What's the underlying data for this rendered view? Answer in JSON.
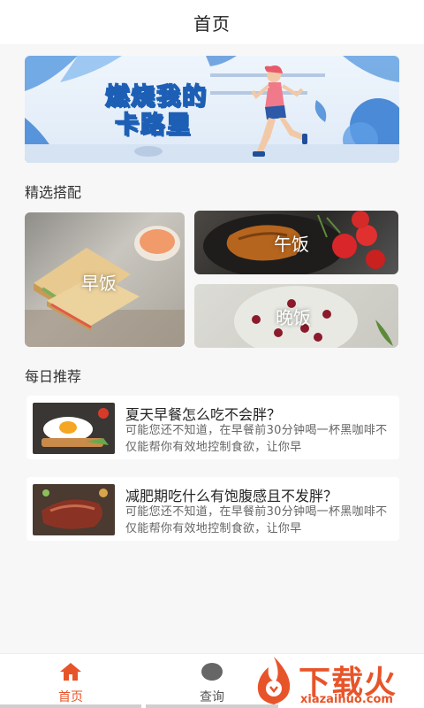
{
  "header": {
    "title": "首页"
  },
  "banner": {
    "line1": "燃烧我的",
    "line2": "卡路里"
  },
  "featured": {
    "title": "精选搭配",
    "cards": [
      {
        "label": "早饭"
      },
      {
        "label": "午饭"
      },
      {
        "label": "晚饭"
      }
    ]
  },
  "daily": {
    "title": "每日推荐",
    "items": [
      {
        "title": "夏天早餐怎么吃不会胖？",
        "desc": "可能您还不知道，在早餐前30分钟喝一杯黑咖啡不仅能帮你有效地控制食欲，让你早"
      },
      {
        "title": "减肥期吃什么有饱腹感且不发胖？",
        "desc": "可能您还不知道，在早餐前30分钟喝一杯黑咖啡不仅能帮你有效地控制食欲，让你早"
      }
    ]
  },
  "tabbar": {
    "tabs": [
      {
        "label": "首页",
        "icon": "home-icon",
        "active": true
      },
      {
        "label": "查询",
        "icon": "search-icon",
        "active": false
      }
    ]
  },
  "watermark": {
    "brand": "下载火",
    "url": "xiazaihuo.com"
  },
  "colors": {
    "accent": "#e8542a",
    "banner_text_outline": "#1d5fb5"
  }
}
